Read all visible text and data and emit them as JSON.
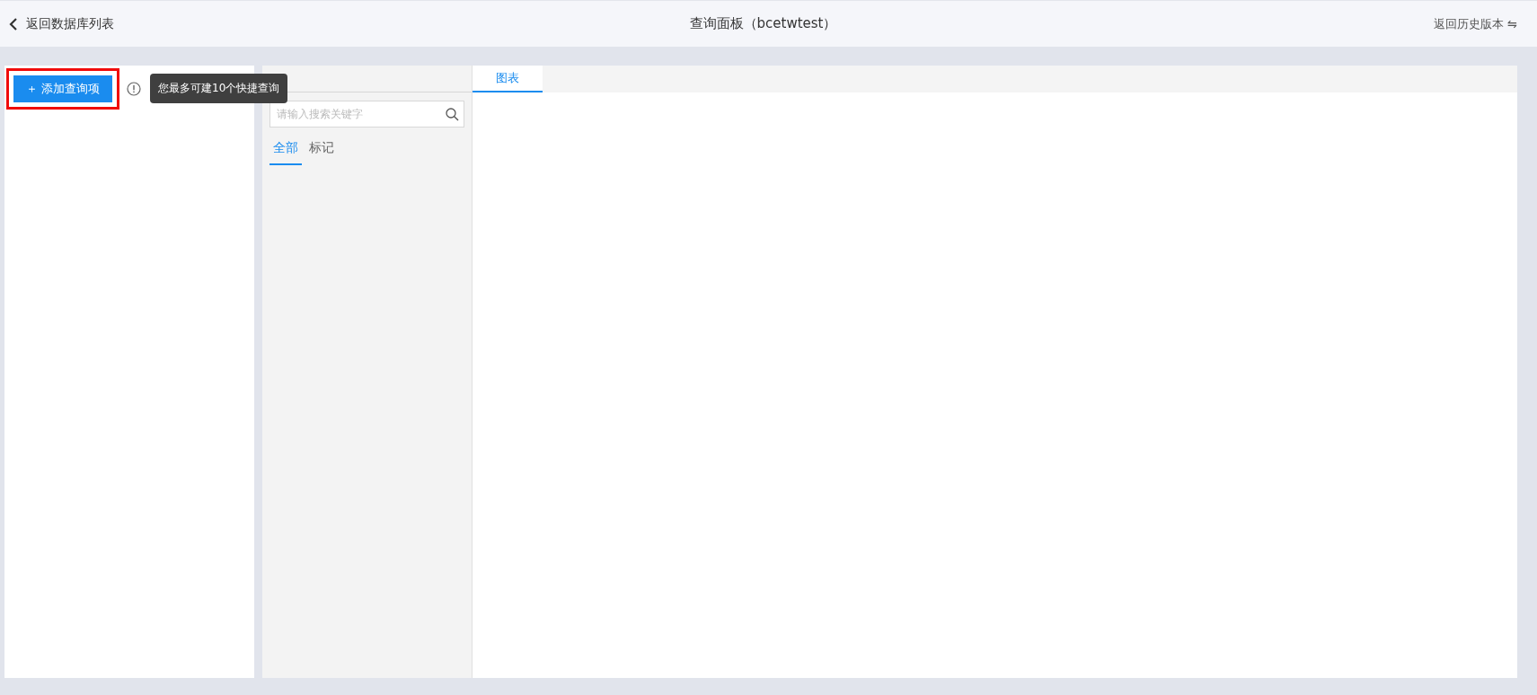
{
  "header": {
    "back_link": "返回数据库列表",
    "title": "查询面板（bcetwtest）",
    "history_link": "返回历史版本 ⇋"
  },
  "left_panel": {
    "add_button": "＋ 添加查询项",
    "tooltip": "您最多可建10个快捷查询",
    "highlighted": true
  },
  "middle_panel": {
    "search": {
      "placeholder": "请输入搜索关键字"
    },
    "tabs": [
      {
        "label": "全部",
        "selected": true
      },
      {
        "label": "标记",
        "selected": false
      }
    ]
  },
  "right_panel": {
    "tabs": [
      {
        "label": "图表",
        "selected": true
      }
    ]
  }
}
